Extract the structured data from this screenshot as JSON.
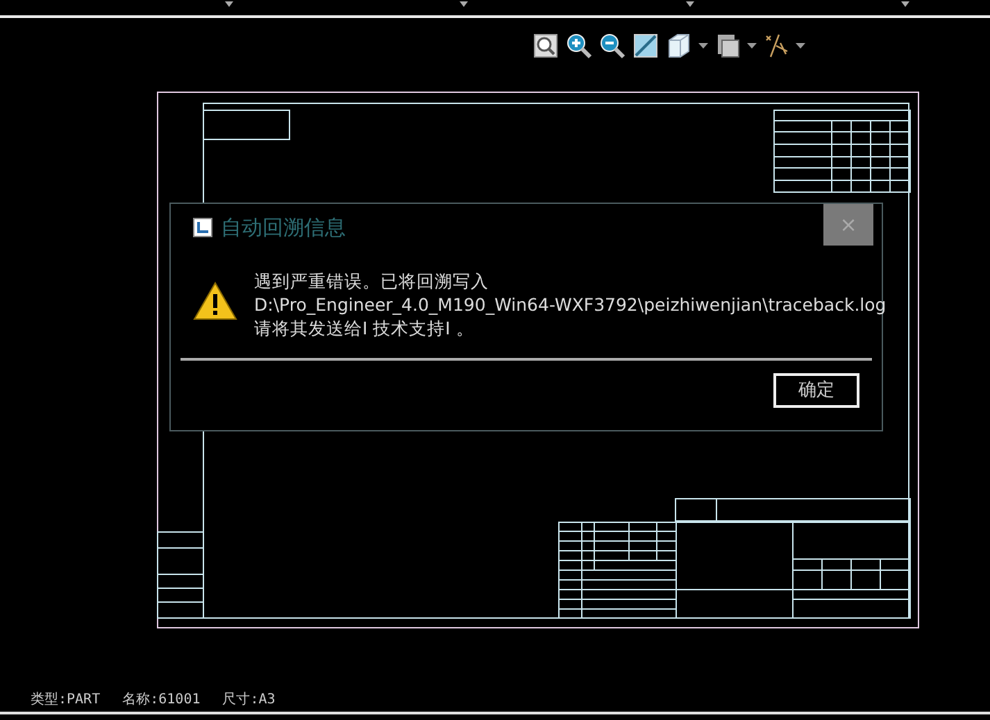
{
  "toolbar": [
    {
      "kind": "zoom-fit",
      "dropdown": false
    },
    {
      "kind": "zoom-in",
      "dropdown": false
    },
    {
      "kind": "zoom-out",
      "dropdown": false
    },
    {
      "kind": "shade",
      "dropdown": false
    },
    {
      "kind": "cube",
      "dropdown": true
    },
    {
      "kind": "layers",
      "dropdown": true
    },
    {
      "kind": "axes",
      "dropdown": true
    }
  ],
  "dialog": {
    "title": "自动回溯信息",
    "close": "×",
    "message": [
      "遇到严重错误。已将回溯写入",
      "D:\\Pro_Engineer_4.0_M190_Win64-WXF3792\\peizhiwenjian\\traceback.log",
      "请将其发送给I  技术支持I  。"
    ],
    "button": "确定"
  },
  "status_bar": [
    {
      "text": "类型:PART"
    },
    {
      "text": "名称:61001"
    },
    {
      "text": "尺寸:A3"
    }
  ]
}
